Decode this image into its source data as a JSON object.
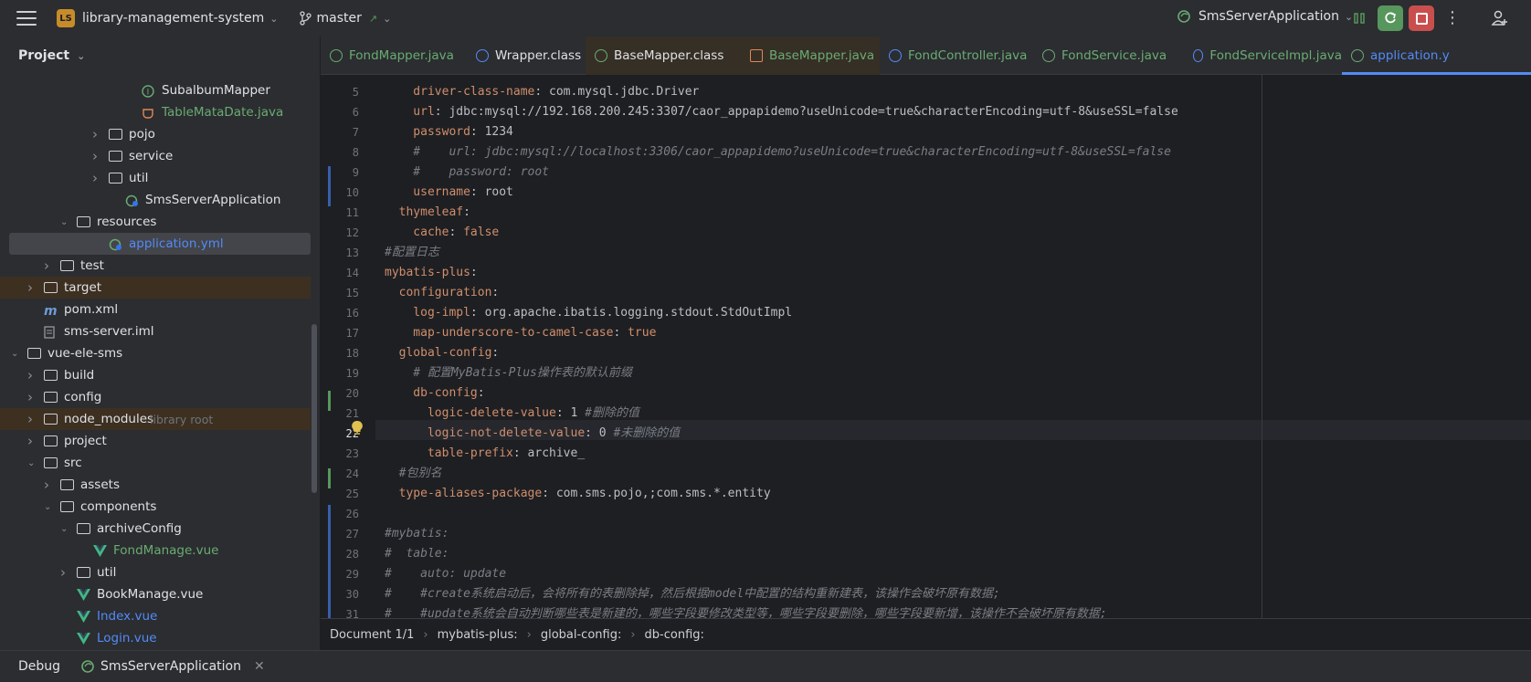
{
  "titlebar": {
    "project_badge": "LS",
    "project_name": "library-management-system",
    "branch": "master",
    "run_config": "SmsServerApplication"
  },
  "sidebar": {
    "title": "Project",
    "rows": [
      {
        "label": "SubalbumMapper",
        "icon": "class-icon",
        "color": "#dfe1e5",
        "sub": ""
      },
      {
        "label": "TableMataDate.java",
        "icon": "java-file-icon",
        "color": "#6aab73",
        "sub": ""
      },
      {
        "label": "pojo",
        "icon": "folder-icon",
        "color": "#dfe1e5",
        "sub": ""
      },
      {
        "label": "service",
        "icon": "folder-icon",
        "color": "#dfe1e5",
        "sub": ""
      },
      {
        "label": "util",
        "icon": "folder-icon",
        "color": "#dfe1e5",
        "sub": ""
      },
      {
        "label": "SmsServerApplication",
        "icon": "spring-class-icon",
        "color": "#dfe1e5",
        "sub": ""
      },
      {
        "label": "resources",
        "icon": "folder-icon",
        "color": "#dfe1e5",
        "sub": ""
      },
      {
        "label": "application.yml",
        "icon": "yml-icon",
        "color": "#548af7",
        "sub": ""
      },
      {
        "label": "test",
        "icon": "folder-icon",
        "color": "#dfe1e5",
        "sub": ""
      },
      {
        "label": "target",
        "icon": "folder-icon",
        "color": "#dfe1e5",
        "sub": ""
      },
      {
        "label": "pom.xml",
        "icon": "maven-icon",
        "color": "#dfe1e5",
        "sub": ""
      },
      {
        "label": "sms-server.iml",
        "icon": "iml-file-icon",
        "color": "#dfe1e5",
        "sub": ""
      },
      {
        "label": "vue-ele-sms",
        "icon": "folder-icon",
        "color": "#dfe1e5",
        "sub": ""
      },
      {
        "label": "build",
        "icon": "folder-icon",
        "color": "#dfe1e5",
        "sub": ""
      },
      {
        "label": "config",
        "icon": "folder-icon",
        "color": "#dfe1e5",
        "sub": ""
      },
      {
        "label": "node_modules",
        "icon": "folder-icon",
        "color": "#dfe1e5",
        "sub": "library root"
      },
      {
        "label": "project",
        "icon": "folder-icon",
        "color": "#dfe1e5",
        "sub": ""
      },
      {
        "label": "src",
        "icon": "folder-icon",
        "color": "#dfe1e5",
        "sub": ""
      },
      {
        "label": "assets",
        "icon": "folder-icon",
        "color": "#dfe1e5",
        "sub": ""
      },
      {
        "label": "components",
        "icon": "folder-icon",
        "color": "#dfe1e5",
        "sub": ""
      },
      {
        "label": "archiveConfig",
        "icon": "folder-icon",
        "color": "#dfe1e5",
        "sub": ""
      },
      {
        "label": "FondManage.vue",
        "icon": "vue-icon",
        "color": "#6aab73",
        "sub": ""
      },
      {
        "label": "util",
        "icon": "folder-icon",
        "color": "#dfe1e5",
        "sub": ""
      },
      {
        "label": "BookManage.vue",
        "icon": "vue-icon",
        "color": "#dfe1e5",
        "sub": ""
      },
      {
        "label": "Index.vue",
        "icon": "vue-icon",
        "color": "#548af7",
        "sub": ""
      },
      {
        "label": "Login.vue",
        "icon": "vue-icon",
        "color": "#548af7",
        "sub": ""
      }
    ]
  },
  "tabs": [
    {
      "label": "FondMapper.java",
      "icon": "interface-icon",
      "color": "#6aab73"
    },
    {
      "label": "Wrapper.class",
      "icon": "class-icon",
      "color": "#dfe1e5"
    },
    {
      "label": "BaseMapper.class",
      "icon": "interface-icon",
      "color": "#dfe1e5"
    },
    {
      "label": "BaseMapper.java",
      "icon": "java-file-icon",
      "color": "#6aab73"
    },
    {
      "label": "FondController.java",
      "icon": "class-icon",
      "color": "#6aab73"
    },
    {
      "label": "FondService.java",
      "icon": "interface-icon",
      "color": "#6aab73"
    },
    {
      "label": "FondServiceImpl.java",
      "icon": "class-icon",
      "color": "#6aab73"
    },
    {
      "label": "application.y",
      "icon": "yml-icon",
      "color": "#548af7"
    }
  ],
  "lines": [
    {
      "n": "5",
      "parts": [
        [
          "k",
          "    driver-class-name"
        ],
        [
          "s",
          ": com.mysql.jdbc.Driver"
        ]
      ]
    },
    {
      "n": "6",
      "parts": [
        [
          "k",
          "    url"
        ],
        [
          "s",
          ": jdbc:mysql://192.168.200.245:3307/caor_appapidemo?useUnicode=true&characterEncoding=utf-8&useSSL=false"
        ]
      ]
    },
    {
      "n": "7",
      "parts": [
        [
          "k",
          "    password"
        ],
        [
          "s",
          ": 1234"
        ]
      ]
    },
    {
      "n": "8",
      "parts": [
        [
          "c",
          "    #    url: jdbc:mysql://localhost:3306/caor_appapidemo?useUnicode=true&characterEncoding=utf-8&useSSL=false"
        ]
      ]
    },
    {
      "n": "9",
      "parts": [
        [
          "c",
          "    #    password: root"
        ]
      ]
    },
    {
      "n": "10",
      "parts": [
        [
          "k",
          "    username"
        ],
        [
          "s",
          ": root"
        ]
      ]
    },
    {
      "n": "11",
      "parts": [
        [
          "k",
          "  thymeleaf"
        ],
        [
          "s",
          ":"
        ]
      ]
    },
    {
      "n": "12",
      "parts": [
        [
          "k",
          "    cache"
        ],
        [
          "s",
          ": "
        ],
        [
          "k",
          "false"
        ]
      ]
    },
    {
      "n": "13",
      "parts": [
        [
          "c",
          "#配置日志"
        ]
      ]
    },
    {
      "n": "14",
      "parts": [
        [
          "k",
          "mybatis-plus"
        ],
        [
          "s",
          ":"
        ]
      ]
    },
    {
      "n": "15",
      "parts": [
        [
          "k",
          "  configuration"
        ],
        [
          "s",
          ":"
        ]
      ]
    },
    {
      "n": "16",
      "parts": [
        [
          "k",
          "    log-impl"
        ],
        [
          "s",
          ": org.apache.ibatis.logging.stdout.StdOutImpl"
        ]
      ]
    },
    {
      "n": "17",
      "parts": [
        [
          "k",
          "    map-underscore-to-camel-case"
        ],
        [
          "s",
          ": "
        ],
        [
          "k",
          "true"
        ]
      ]
    },
    {
      "n": "18",
      "parts": [
        [
          "k",
          "  global-config"
        ],
        [
          "s",
          ":"
        ]
      ]
    },
    {
      "n": "19",
      "parts": [
        [
          "c",
          "    # 配置MyBatis-Plus操作表的默认前缀"
        ]
      ]
    },
    {
      "n": "20",
      "parts": [
        [
          "k",
          "    db-config"
        ],
        [
          "s",
          ":"
        ]
      ]
    },
    {
      "n": "21",
      "parts": [
        [
          "k",
          "      logic-delete-value"
        ],
        [
          "s",
          ": 1 "
        ],
        [
          "c",
          "#删除的值"
        ]
      ]
    },
    {
      "n": "22",
      "parts": [
        [
          "k",
          "      logic-not-delete-value"
        ],
        [
          "s",
          ": 0 "
        ],
        [
          "c",
          "#未删除的值"
        ]
      ]
    },
    {
      "n": "23",
      "parts": [
        [
          "k",
          "      table-prefix"
        ],
        [
          "s",
          ": archive_"
        ]
      ]
    },
    {
      "n": "24",
      "parts": [
        [
          "c",
          "  #包别名"
        ]
      ]
    },
    {
      "n": "25",
      "parts": [
        [
          "k",
          "  type-aliases-package"
        ],
        [
          "s",
          ": com.sms.pojo,;com.sms.*.entity"
        ]
      ]
    },
    {
      "n": "26",
      "parts": [
        [
          "s",
          ""
        ]
      ]
    },
    {
      "n": "27",
      "parts": [
        [
          "c",
          "#mybatis:"
        ]
      ]
    },
    {
      "n": "28",
      "parts": [
        [
          "c",
          "#  table:"
        ]
      ]
    },
    {
      "n": "29",
      "parts": [
        [
          "c",
          "#    auto: update"
        ]
      ]
    },
    {
      "n": "30",
      "parts": [
        [
          "c",
          "#    #create系统启动后，会将所有的表删除掉，然后根据model中配置的结构重新建表，该操作会破坏原有数据;"
        ]
      ]
    },
    {
      "n": "31",
      "parts": [
        [
          "c",
          "#    #update系统会自动判断哪些表是新建的，哪些字段要修改类型等，哪些字段要删除，哪些字段要新增，该操作不会破坏原有数据;"
        ]
      ]
    }
  ],
  "breadcrumbs": [
    "Document 1/1",
    "mybatis-plus:",
    "global-config:",
    "db-config:"
  ],
  "bottombar": {
    "debug_label": "Debug",
    "session": "SmsServerApplication"
  },
  "colors": {
    "accent": "#548af7",
    "added": "#57965c",
    "modified": "#375fad",
    "stop": "#c94f4f"
  }
}
